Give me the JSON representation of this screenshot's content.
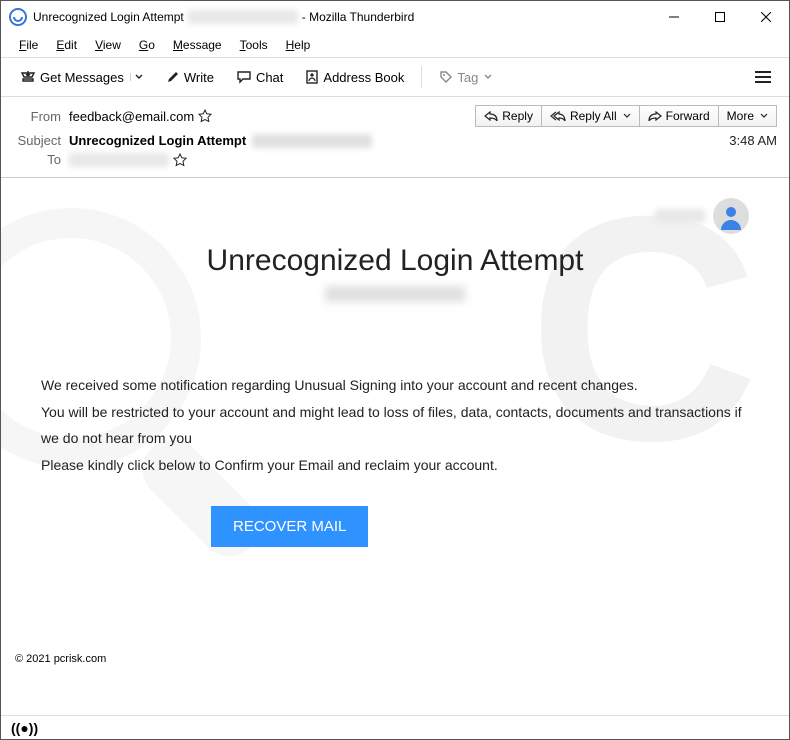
{
  "titlebar": {
    "prefix": "Unrecognized Login Attempt",
    "suffix": "- Mozilla Thunderbird"
  },
  "menubar": [
    "File",
    "Edit",
    "View",
    "Go",
    "Message",
    "Tools",
    "Help"
  ],
  "toolbar": {
    "get_messages": "Get Messages",
    "write": "Write",
    "chat": "Chat",
    "address_book": "Address Book",
    "tag": "Tag"
  },
  "message_header": {
    "from_label": "From",
    "from_value": "feedback@email.com",
    "subject_label": "Subject",
    "subject_value": "Unrecognized Login Attempt",
    "to_label": "To",
    "time": "3:48 AM",
    "actions": {
      "reply": "Reply",
      "reply_all": "Reply All",
      "forward": "Forward",
      "more": "More"
    }
  },
  "email_body": {
    "title": "Unrecognized Login Attempt",
    "p1": "We received some notification regarding Unusual Signing into your account and recent changes.",
    "p2": "You will be restricted to your account and might lead to loss of files, data, contacts, documents and transactions if we do not hear from you",
    "p3": "Please kindly click below to Confirm your Email and reclaim your account.",
    "button": "RECOVER MAIL"
  },
  "copyright": "© 2021 pcrisk.com",
  "status": "((●))"
}
